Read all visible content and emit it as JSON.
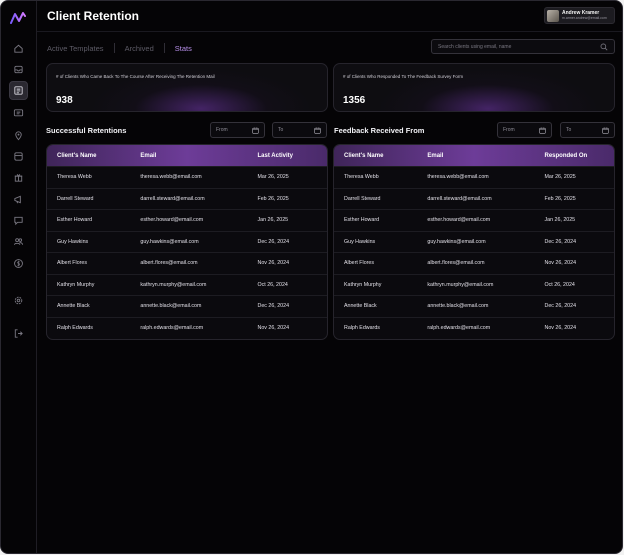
{
  "header": {
    "title": "Client Retention"
  },
  "user": {
    "name": "Andrew Kramer",
    "email": "m.armer.andrew@email.com"
  },
  "tabs": [
    {
      "label": "Active Templates",
      "active": false
    },
    {
      "label": "Archived",
      "active": false
    },
    {
      "label": "Stats",
      "active": true
    }
  ],
  "search": {
    "placeholder": "Search clients using email, name"
  },
  "stats": [
    {
      "label": "# of Clients Who Came Back To The Course After Receiving The Retention Mail",
      "value": "938"
    },
    {
      "label": "# of Clients Who Responded To The Feedback Survey Form",
      "value": "1356"
    }
  ],
  "sidebar": {
    "icons": [
      "home-icon",
      "inbox-icon",
      "template-icon",
      "chat-box-icon",
      "location-icon",
      "database-icon",
      "gift-icon",
      "megaphone-icon",
      "message-icon",
      "users-icon",
      "dollar-icon",
      "settings-icon",
      "logout-icon"
    ],
    "active": "template-icon"
  },
  "retentions": {
    "title": "Successful Retentions",
    "from_label": "From",
    "to_label": "To",
    "columns": [
      "Client's Name",
      "Email",
      "Last Activity"
    ],
    "rows": [
      [
        "Theresa Webb",
        "theresa.webb@email.com",
        "Mar 26, 2025"
      ],
      [
        "Darrell Steward",
        "darrell.steward@email.com",
        "Feb 26, 2025"
      ],
      [
        "Esther Howard",
        "esther.howard@email.com",
        "Jan 26, 2025"
      ],
      [
        "Guy Hawkins",
        "guy.hawkins@email.com",
        "Dec 26, 2024"
      ],
      [
        "Albert Flores",
        "albert.flores@email.com",
        "Nov 26, 2024"
      ],
      [
        "Kathryn Murphy",
        "kathryn.murphy@email.com",
        "Oct 26, 2024"
      ],
      [
        "Annette Black",
        "annette.black@email.com",
        "Dec 26, 2024"
      ],
      [
        "Ralph Edwards",
        "ralph.edwards@email.com",
        "Nov 26, 2024"
      ]
    ]
  },
  "feedback": {
    "title": "Feedback Received From",
    "from_label": "From",
    "to_label": "To",
    "columns": [
      "Client's Name",
      "Email",
      "Responded On"
    ],
    "rows": [
      [
        "Theresa Webb",
        "theresa.webb@email.com",
        "Mar 26, 2025"
      ],
      [
        "Darrell Steward",
        "darrell.steward@email.com",
        "Feb 26, 2025"
      ],
      [
        "Esther Howard",
        "esther.howard@email.com",
        "Jan 26, 2025"
      ],
      [
        "Guy Hawkins",
        "guy.hawkins@email.com",
        "Dec 26, 2024"
      ],
      [
        "Albert Flores",
        "albert.flores@email.com",
        "Nov 26, 2024"
      ],
      [
        "Kathryn Murphy",
        "kathryn.murphy@email.com",
        "Oct 26, 2024"
      ],
      [
        "Annette Black",
        "annette.black@email.com",
        "Dec 26, 2024"
      ],
      [
        "Ralph Edwards",
        "ralph.edwards@email.com",
        "Nov 26, 2024"
      ]
    ]
  },
  "colors": {
    "accent": "#b68ee8",
    "header_purple": "#6d3c98",
    "background": "#050406"
  }
}
